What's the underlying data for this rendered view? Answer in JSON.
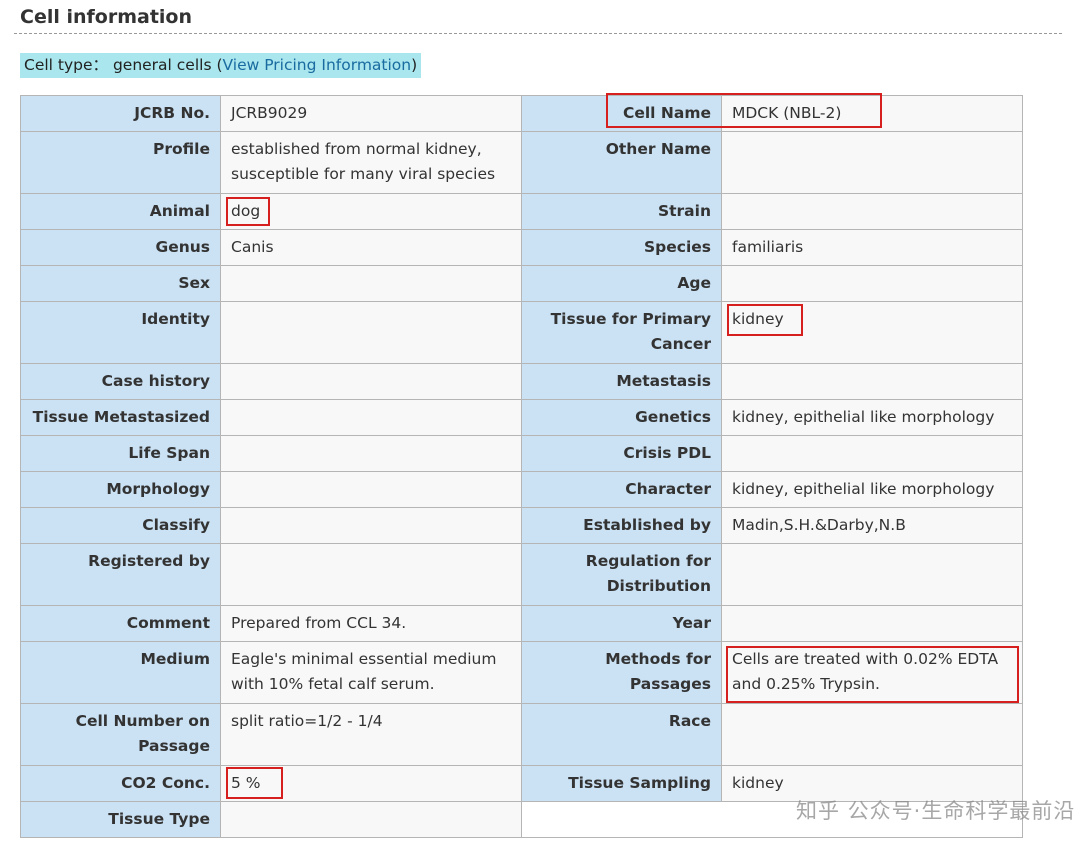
{
  "section": {
    "title": "Cell information"
  },
  "cell_type": {
    "prefix": "Cell type： general cells (",
    "link": "View Pricing Information",
    "suffix": ")"
  },
  "rows": [
    {
      "left_label": "JCRB No.",
      "left_value": "JCRB9029",
      "right_label": "Cell Name",
      "right_value": "MDCK (NBL-2)"
    },
    {
      "left_label": "Profile",
      "left_value": "established from normal kidney, susceptible for many viral species",
      "right_label": "Other Name",
      "right_value": ""
    },
    {
      "left_label": "Animal",
      "left_value": "dog",
      "right_label": "Strain",
      "right_value": ""
    },
    {
      "left_label": "Genus",
      "left_value": "Canis",
      "right_label": "Species",
      "right_value": "familiaris"
    },
    {
      "left_label": "Sex",
      "left_value": "",
      "right_label": "Age",
      "right_value": ""
    },
    {
      "left_label": "Identity",
      "left_value": "",
      "right_label": "Tissue for Primary Cancer",
      "right_value": "kidney"
    },
    {
      "left_label": "Case history",
      "left_value": "",
      "right_label": "Metastasis",
      "right_value": ""
    },
    {
      "left_label": "Tissue Metastasized",
      "left_value": "",
      "right_label": "Genetics",
      "right_value": "kidney, epithelial like morphology"
    },
    {
      "left_label": "Life Span",
      "left_value": "",
      "right_label": "Crisis PDL",
      "right_value": ""
    },
    {
      "left_label": "Morphology",
      "left_value": "",
      "right_label": "Character",
      "right_value": "kidney, epithelial like morphology"
    },
    {
      "left_label": "Classify",
      "left_value": "",
      "right_label": "Established by",
      "right_value": "Madin,S.H.&Darby,N.B"
    },
    {
      "left_label": "Registered by",
      "left_value": "",
      "right_label": "Regulation for Distribution",
      "right_value": ""
    },
    {
      "left_label": "Comment",
      "left_value": "Prepared from CCL 34.",
      "right_label": "Year",
      "right_value": ""
    },
    {
      "left_label": "Medium",
      "left_value": "Eagle's minimal essential medium with 10% fetal calf serum.",
      "right_label": "Methods for Passages",
      "right_value": "Cells are treated with 0.02% EDTA and 0.25% Trypsin."
    },
    {
      "left_label": "Cell Number on Passage",
      "left_value": "split ratio=1/2 - 1/4",
      "right_label": "Race",
      "right_value": ""
    },
    {
      "left_label": "CO2 Conc.",
      "left_value": "5 %",
      "right_label": "Tissue Sampling",
      "right_value": "kidney"
    },
    {
      "left_label": "Tissue Type",
      "left_value": ""
    }
  ],
  "watermark": "知乎 公众号·生命科学最前沿",
  "colors": {
    "label_bg": "#cbe2f4",
    "value_bg": "#f8f8f8",
    "highlight": "#d62020",
    "banner_bg": "#a9e6ee",
    "link": "#1a6ba0"
  }
}
